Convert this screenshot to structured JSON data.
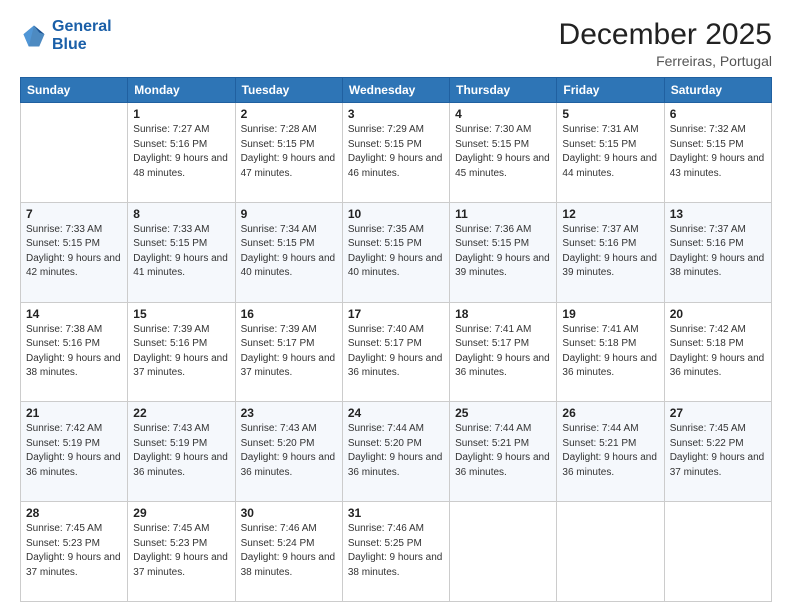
{
  "logo": {
    "line1": "General",
    "line2": "Blue"
  },
  "title": "December 2025",
  "subtitle": "Ferreiras, Portugal",
  "weekdays": [
    "Sunday",
    "Monday",
    "Tuesday",
    "Wednesday",
    "Thursday",
    "Friday",
    "Saturday"
  ],
  "weeks": [
    [
      {
        "day": "",
        "info": ""
      },
      {
        "day": "1",
        "info": "Sunrise: 7:27 AM\nSunset: 5:16 PM\nDaylight: 9 hours\nand 48 minutes."
      },
      {
        "day": "2",
        "info": "Sunrise: 7:28 AM\nSunset: 5:15 PM\nDaylight: 9 hours\nand 47 minutes."
      },
      {
        "day": "3",
        "info": "Sunrise: 7:29 AM\nSunset: 5:15 PM\nDaylight: 9 hours\nand 46 minutes."
      },
      {
        "day": "4",
        "info": "Sunrise: 7:30 AM\nSunset: 5:15 PM\nDaylight: 9 hours\nand 45 minutes."
      },
      {
        "day": "5",
        "info": "Sunrise: 7:31 AM\nSunset: 5:15 PM\nDaylight: 9 hours\nand 44 minutes."
      },
      {
        "day": "6",
        "info": "Sunrise: 7:32 AM\nSunset: 5:15 PM\nDaylight: 9 hours\nand 43 minutes."
      }
    ],
    [
      {
        "day": "7",
        "info": "Sunrise: 7:33 AM\nSunset: 5:15 PM\nDaylight: 9 hours\nand 42 minutes."
      },
      {
        "day": "8",
        "info": "Sunrise: 7:33 AM\nSunset: 5:15 PM\nDaylight: 9 hours\nand 41 minutes."
      },
      {
        "day": "9",
        "info": "Sunrise: 7:34 AM\nSunset: 5:15 PM\nDaylight: 9 hours\nand 40 minutes."
      },
      {
        "day": "10",
        "info": "Sunrise: 7:35 AM\nSunset: 5:15 PM\nDaylight: 9 hours\nand 40 minutes."
      },
      {
        "day": "11",
        "info": "Sunrise: 7:36 AM\nSunset: 5:15 PM\nDaylight: 9 hours\nand 39 minutes."
      },
      {
        "day": "12",
        "info": "Sunrise: 7:37 AM\nSunset: 5:16 PM\nDaylight: 9 hours\nand 39 minutes."
      },
      {
        "day": "13",
        "info": "Sunrise: 7:37 AM\nSunset: 5:16 PM\nDaylight: 9 hours\nand 38 minutes."
      }
    ],
    [
      {
        "day": "14",
        "info": "Sunrise: 7:38 AM\nSunset: 5:16 PM\nDaylight: 9 hours\nand 38 minutes."
      },
      {
        "day": "15",
        "info": "Sunrise: 7:39 AM\nSunset: 5:16 PM\nDaylight: 9 hours\nand 37 minutes."
      },
      {
        "day": "16",
        "info": "Sunrise: 7:39 AM\nSunset: 5:17 PM\nDaylight: 9 hours\nand 37 minutes."
      },
      {
        "day": "17",
        "info": "Sunrise: 7:40 AM\nSunset: 5:17 PM\nDaylight: 9 hours\nand 36 minutes."
      },
      {
        "day": "18",
        "info": "Sunrise: 7:41 AM\nSunset: 5:17 PM\nDaylight: 9 hours\nand 36 minutes."
      },
      {
        "day": "19",
        "info": "Sunrise: 7:41 AM\nSunset: 5:18 PM\nDaylight: 9 hours\nand 36 minutes."
      },
      {
        "day": "20",
        "info": "Sunrise: 7:42 AM\nSunset: 5:18 PM\nDaylight: 9 hours\nand 36 minutes."
      }
    ],
    [
      {
        "day": "21",
        "info": "Sunrise: 7:42 AM\nSunset: 5:19 PM\nDaylight: 9 hours\nand 36 minutes."
      },
      {
        "day": "22",
        "info": "Sunrise: 7:43 AM\nSunset: 5:19 PM\nDaylight: 9 hours\nand 36 minutes."
      },
      {
        "day": "23",
        "info": "Sunrise: 7:43 AM\nSunset: 5:20 PM\nDaylight: 9 hours\nand 36 minutes."
      },
      {
        "day": "24",
        "info": "Sunrise: 7:44 AM\nSunset: 5:20 PM\nDaylight: 9 hours\nand 36 minutes."
      },
      {
        "day": "25",
        "info": "Sunrise: 7:44 AM\nSunset: 5:21 PM\nDaylight: 9 hours\nand 36 minutes."
      },
      {
        "day": "26",
        "info": "Sunrise: 7:44 AM\nSunset: 5:21 PM\nDaylight: 9 hours\nand 36 minutes."
      },
      {
        "day": "27",
        "info": "Sunrise: 7:45 AM\nSunset: 5:22 PM\nDaylight: 9 hours\nand 37 minutes."
      }
    ],
    [
      {
        "day": "28",
        "info": "Sunrise: 7:45 AM\nSunset: 5:23 PM\nDaylight: 9 hours\nand 37 minutes."
      },
      {
        "day": "29",
        "info": "Sunrise: 7:45 AM\nSunset: 5:23 PM\nDaylight: 9 hours\nand 37 minutes."
      },
      {
        "day": "30",
        "info": "Sunrise: 7:46 AM\nSunset: 5:24 PM\nDaylight: 9 hours\nand 38 minutes."
      },
      {
        "day": "31",
        "info": "Sunrise: 7:46 AM\nSunset: 5:25 PM\nDaylight: 9 hours\nand 38 minutes."
      },
      {
        "day": "",
        "info": ""
      },
      {
        "day": "",
        "info": ""
      },
      {
        "day": "",
        "info": ""
      }
    ]
  ]
}
